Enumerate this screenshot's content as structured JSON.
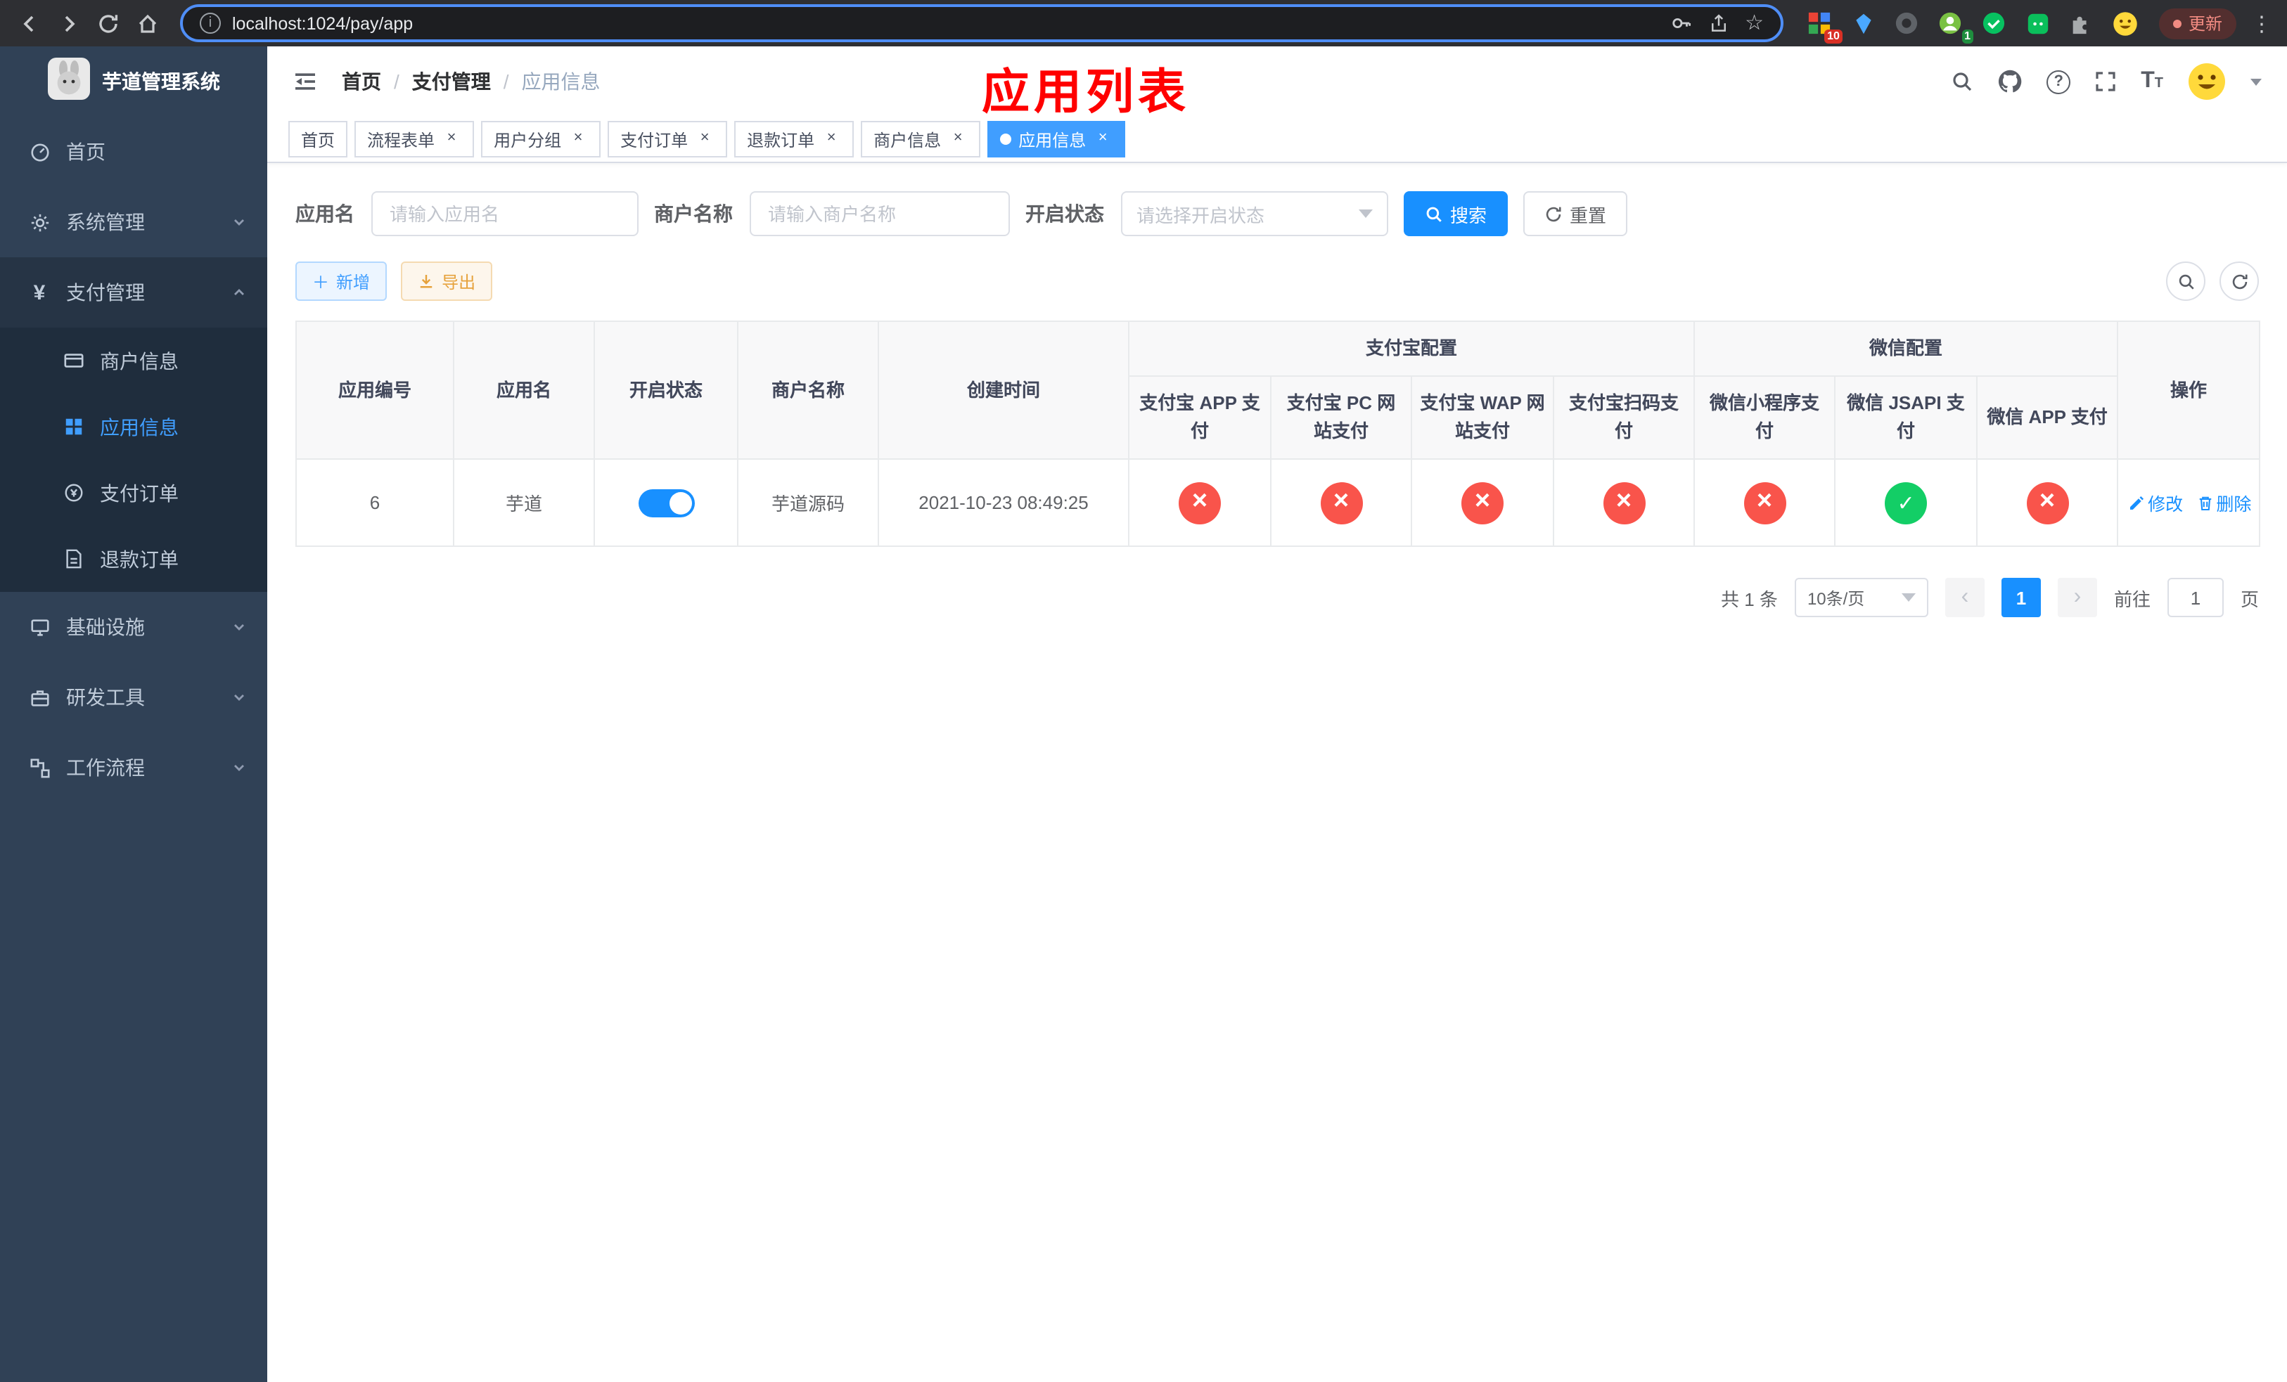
{
  "colors": {
    "accent": "#1890ff",
    "success": "#13ce66",
    "danger": "#f9544b",
    "annotation": "#ff0000",
    "sidebar_bg": "#304156"
  },
  "browser": {
    "url": "localhost:1024/pay/app",
    "update_button": "更新",
    "ext_badge_grid": "10",
    "ext_badge_avatar": "1"
  },
  "header": {
    "annotation": "应用列表",
    "breadcrumb": [
      "首页",
      "支付管理",
      "应用信息"
    ]
  },
  "sidebar": {
    "logo_title": "芋道管理系统",
    "items": [
      {
        "label": "首页"
      },
      {
        "label": "系统管理"
      },
      {
        "label": "支付管理"
      },
      {
        "label": "商户信息"
      },
      {
        "label": "应用信息"
      },
      {
        "label": "支付订单"
      },
      {
        "label": "退款订单"
      },
      {
        "label": "基础设施"
      },
      {
        "label": "研发工具"
      },
      {
        "label": "工作流程"
      }
    ]
  },
  "tabs": [
    {
      "label": "首页"
    },
    {
      "label": "流程表单"
    },
    {
      "label": "用户分组"
    },
    {
      "label": "支付订单"
    },
    {
      "label": "退款订单"
    },
    {
      "label": "商户信息"
    },
    {
      "label": "应用信息"
    }
  ],
  "filters": {
    "app_name_label": "应用名",
    "app_name_placeholder": "请输入应用名",
    "merchant_label": "商户名称",
    "merchant_placeholder": "请输入商户名称",
    "status_label": "开启状态",
    "status_placeholder": "请选择开启状态",
    "search_button": "搜索",
    "reset_button": "重置"
  },
  "toolbar": {
    "add_button": "新增",
    "export_button": "导出"
  },
  "table": {
    "col_app_id": "应用编号",
    "col_app_name": "应用名",
    "col_status": "开启状态",
    "col_merchant": "商户名称",
    "col_created": "创建时间",
    "group_alipay": "支付宝配置",
    "col_alipay_app": "支付宝 APP 支付",
    "col_alipay_pc": "支付宝 PC 网站支付",
    "col_alipay_wap": "支付宝 WAP 网站支付",
    "col_alipay_scan": "支付宝扫码支付",
    "group_wechat": "微信配置",
    "col_wechat_mini": "微信小程序支付",
    "col_wechat_jsapi": "微信 JSAPI 支付",
    "col_wechat_app": "微信 APP 支付",
    "col_action": "操作",
    "row": {
      "app_id": "6",
      "app_name": "芋道",
      "status_on": true,
      "merchant": "芋道源码",
      "created": "2021-10-23 08:49:25",
      "configs": [
        false,
        false,
        false,
        false,
        false,
        true,
        false
      ],
      "edit_link": "修改",
      "delete_link": "删除"
    }
  },
  "pagination": {
    "total": "共 1 条",
    "page_size": "10条/页",
    "page": "1",
    "goto_prefix": "前往",
    "goto_value": "1",
    "goto_suffix": "页"
  }
}
